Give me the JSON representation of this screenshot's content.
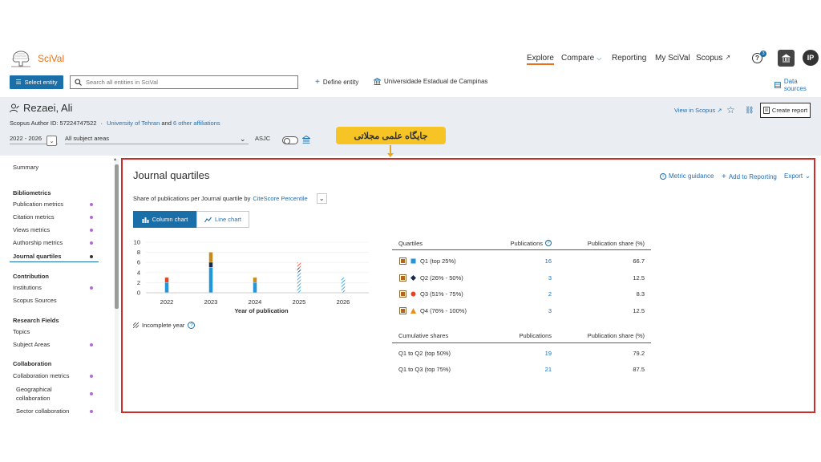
{
  "app": {
    "brand": "SciVal",
    "nav": [
      "Explore",
      "Compare",
      "Reporting",
      "My SciVal",
      "Scopus"
    ],
    "help_badge": "3",
    "user_initials": "IP"
  },
  "toolbar": {
    "select_entity": "Select entity",
    "search_placeholder": "Search all entities in SciVal",
    "define_entity": "Define entity",
    "institution": "Universidade Estadual de Campinas",
    "data_sources": "Data sources"
  },
  "profile": {
    "name": "Rezaei, Ali",
    "author_id": "Scopus Author ID: 57224747522",
    "separator": "·",
    "affiliation": "University of Tehran",
    "and": "and",
    "other_affiliations": "6 other affiliations",
    "years": "2022 - 2026",
    "subject_areas": "All subject areas",
    "asjc": "ASJC",
    "view_in_scopus": "View in Scopus ↗",
    "create_report": "Create report"
  },
  "callout": {
    "text": "جایگاه علمی مجلاتی"
  },
  "sidebar": {
    "summary": "Summary",
    "groups": [
      {
        "heading": "Bibliometrics",
        "items": [
          "Publication metrics",
          "Citation metrics",
          "Views metrics",
          "Authorship metrics",
          "Journal quartiles"
        ]
      },
      {
        "heading": "Contribution",
        "items": [
          "Institutions",
          "Scopus Sources"
        ]
      },
      {
        "heading": "Research Fields",
        "items": [
          "Topics",
          "Subject Areas"
        ]
      },
      {
        "heading": "Collaboration",
        "items": [
          "Collaboration metrics",
          "Geographical collaboration",
          "Sector collaboration"
        ]
      }
    ]
  },
  "main": {
    "title": "Journal quartiles",
    "metric_guidance": "Metric guidance",
    "add_to_reporting": "Add to Reporting",
    "export": "Export",
    "subline_prefix": "Share of publications per Journal quartile by",
    "subline_metric": "CiteScore Percentile",
    "tab_column": "Column chart",
    "tab_line": "Line chart",
    "incomplete_year": "Incomplete year"
  },
  "chart_data": {
    "type": "bar",
    "stacked": true,
    "xlabel": "Year of publication",
    "categories": [
      "2022",
      "2023",
      "2024",
      "2025",
      "2026"
    ],
    "ylim": [
      0,
      10
    ],
    "yticks": [
      0,
      2,
      4,
      6,
      8,
      10
    ],
    "incomplete_categories": [
      "2025",
      "2026"
    ],
    "series": [
      {
        "name": "Q1 (top 25%)",
        "color": "#2196d9",
        "values": [
          2,
          5,
          2,
          4,
          3
        ]
      },
      {
        "name": "Q2 (26% - 50%)",
        "color": "#1b2a4a",
        "values": [
          0,
          1,
          0,
          1,
          0
        ]
      },
      {
        "name": "Q3 (51% - 75%)",
        "color": "#e8431f",
        "values": [
          1,
          0,
          0,
          1,
          0
        ]
      },
      {
        "name": "Q4 (76% - 100%)",
        "color": "#c98a1c",
        "values": [
          0,
          2,
          1,
          0,
          0
        ]
      }
    ]
  },
  "table": {
    "headers": [
      "Quartiles",
      "Publications",
      "Publication share (%)"
    ],
    "rows": [
      {
        "label": "Q1 (top 25%)",
        "pubs": "16",
        "share": "66.7",
        "color": "#2196d9",
        "shape": "square"
      },
      {
        "label": "Q2 (26% - 50%)",
        "pubs": "3",
        "share": "12.5",
        "color": "#1b2a4a",
        "shape": "diamond"
      },
      {
        "label": "Q3 (51% - 75%)",
        "pubs": "2",
        "share": "8.3",
        "color": "#e8431f",
        "shape": "circle"
      },
      {
        "label": "Q4 (76% - 100%)",
        "pubs": "3",
        "share": "12.5",
        "color": "#e8901f",
        "shape": "triangle"
      }
    ],
    "cum_headers": [
      "Cumulative shares",
      "Publications",
      "Publication share (%)"
    ],
    "cum_rows": [
      {
        "label": "Q1 to Q2 (top 50%)",
        "pubs": "19",
        "share": "79.2"
      },
      {
        "label": "Q1 to Q3 (top 75%)",
        "pubs": "21",
        "share": "87.5"
      }
    ]
  }
}
